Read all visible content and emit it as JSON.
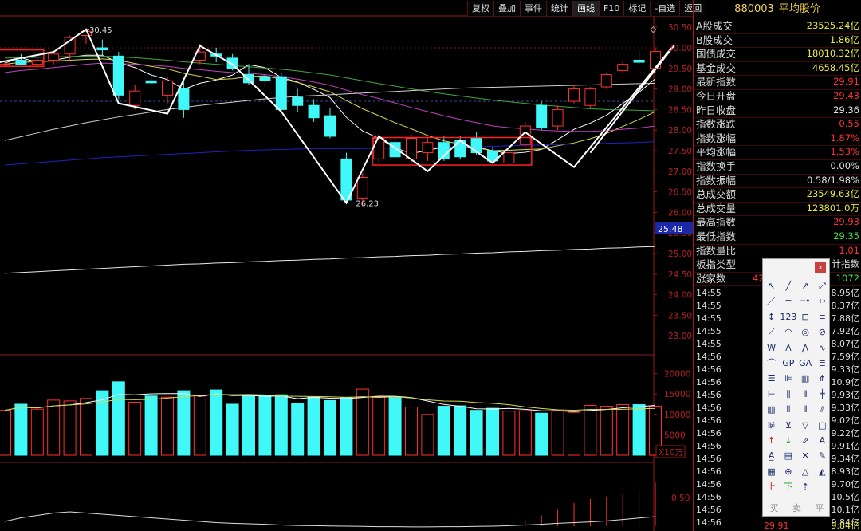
{
  "toolbar": {
    "items": [
      "复权",
      "叠加",
      "事件",
      "统计",
      "画线",
      "F10",
      "标记",
      "-自选",
      "返回"
    ],
    "active": "画线"
  },
  "colors": {
    "up": "#ff3030",
    "down": "#40f8f8",
    "ma5": "#ffffff",
    "ma10": "#d8d850",
    "ma20": "#c040c0",
    "ma30": "#40a840",
    "ma60": "#2020c0",
    "ma250": "#e8e8e8",
    "line": "#ffffff",
    "box": "#ff2020"
  },
  "price_axis": {
    "ticks": [
      "30.50",
      "30.00",
      "29.50",
      "29.00",
      "28.50",
      "28.00",
      "27.50",
      "27.00",
      "26.50",
      "26.00",
      "25.50",
      "25.00",
      "24.50",
      "24.00",
      "23.50",
      "23.00"
    ],
    "current": "25.48"
  },
  "vol_axis": {
    "ticks": [
      "20000",
      "15000",
      "10000",
      "5000"
    ],
    "unit": "X10万"
  },
  "ind_axis": {
    "ticks": [
      "0.50"
    ]
  },
  "annotations": {
    "high": "30.45",
    "low": "26.23"
  },
  "chart_data": {
    "type": "candlestick",
    "ylim": [
      22.7,
      30.75
    ],
    "candles": [
      [
        29.6,
        29.7,
        29.55,
        29.6
      ],
      [
        29.7,
        29.85,
        29.6,
        29.6
      ],
      [
        29.6,
        29.75,
        29.5,
        29.7
      ],
      [
        29.7,
        29.85,
        29.6,
        29.85
      ],
      [
        29.85,
        30.3,
        29.7,
        30.25
      ],
      [
        30.3,
        30.45,
        30.1,
        30.4
      ],
      [
        30.0,
        30.2,
        29.8,
        29.95
      ],
      [
        29.8,
        29.9,
        28.75,
        28.85
      ],
      [
        28.6,
        29.1,
        28.5,
        28.95
      ],
      [
        29.2,
        29.4,
        29.1,
        29.15
      ],
      [
        28.85,
        29.3,
        28.65,
        29.2
      ],
      [
        29.0,
        29.2,
        28.3,
        28.5
      ],
      [
        29.7,
        30.1,
        29.6,
        29.9
      ],
      [
        29.85,
        30.0,
        29.65,
        29.8
      ],
      [
        29.75,
        29.85,
        29.45,
        29.5
      ],
      [
        29.35,
        29.6,
        29.1,
        29.15
      ],
      [
        29.3,
        29.35,
        29.05,
        29.2
      ],
      [
        29.3,
        29.4,
        28.45,
        28.5
      ],
      [
        28.8,
        29.0,
        28.45,
        28.6
      ],
      [
        28.6,
        28.75,
        28.2,
        28.3
      ],
      [
        28.35,
        28.55,
        27.8,
        27.85
      ],
      [
        27.3,
        27.45,
        26.25,
        26.3
      ],
      [
        26.35,
        26.95,
        26.15,
        26.85
      ],
      [
        27.3,
        27.9,
        27.2,
        27.8
      ],
      [
        27.7,
        27.8,
        27.3,
        27.35
      ],
      [
        27.3,
        27.9,
        27.2,
        27.8
      ],
      [
        27.45,
        27.8,
        27.25,
        27.7
      ],
      [
        27.7,
        27.85,
        27.25,
        27.3
      ],
      [
        27.75,
        27.85,
        27.3,
        27.35
      ],
      [
        27.8,
        27.95,
        27.4,
        27.45
      ],
      [
        27.5,
        27.6,
        27.2,
        27.25
      ],
      [
        27.2,
        27.55,
        27.1,
        27.45
      ],
      [
        27.65,
        28.2,
        27.55,
        28.1
      ],
      [
        28.6,
        28.7,
        28.0,
        28.05
      ],
      [
        28.1,
        28.6,
        28.0,
        28.5
      ],
      [
        28.7,
        29.1,
        28.65,
        29.0
      ],
      [
        28.6,
        29.05,
        28.55,
        29.0
      ],
      [
        29.05,
        29.4,
        29.0,
        29.35
      ],
      [
        29.45,
        29.7,
        29.4,
        29.6
      ],
      [
        29.7,
        29.95,
        29.6,
        29.65
      ],
      [
        29.5,
        30.0,
        29.4,
        29.91
      ]
    ],
    "volumes": [
      11000,
      12500,
      11300,
      13500,
      13300,
      13900,
      15800,
      18000,
      13000,
      14500,
      14200,
      15800,
      14500,
      16000,
      12500,
      14500,
      14700,
      14800,
      12700,
      14200,
      13400,
      14200,
      16200,
      14300,
      14100,
      11800,
      10000,
      12000,
      12100,
      11000,
      11500,
      10800,
      10900,
      10300,
      11000,
      10500,
      12200,
      12000,
      12400,
      12400,
      12000
    ],
    "zigzag": [
      [
        -3,
        29.45
      ],
      [
        3,
        29.9
      ],
      [
        5,
        30.45
      ],
      [
        7,
        28.65
      ],
      [
        10,
        28.4
      ],
      [
        12,
        30.05
      ],
      [
        14,
        29.6
      ],
      [
        17,
        28.45
      ],
      [
        21,
        26.23
      ],
      [
        23,
        27.85
      ],
      [
        26,
        27.0
      ],
      [
        28,
        27.75
      ],
      [
        30,
        27.2
      ],
      [
        32,
        27.95
      ],
      [
        35,
        27.1
      ],
      [
        41,
        30.0
      ]
    ],
    "boxes": [
      [
        -1,
        2,
        29.55,
        29.95
      ],
      [
        23,
        32,
        27.15,
        27.82
      ]
    ],
    "ma": [
      {
        "name": "ma5",
        "values": [
          29.63,
          29.76,
          29.65,
          29.7,
          29.77,
          29.82,
          29.82,
          29.64,
          29.52,
          29.34,
          29.23,
          28.99,
          29.14,
          29.22,
          29.34,
          29.59,
          29.52,
          29.28,
          29.17,
          28.99,
          28.79,
          28.31,
          27.98,
          27.8,
          27.57,
          27.43,
          27.51,
          27.59,
          27.58,
          27.59,
          27.5,
          27.43,
          27.46,
          27.53,
          27.77,
          28.02,
          28.17,
          28.36,
          28.65,
          28.92,
          29.25
        ]
      },
      {
        "name": "ma10",
        "values": [
          29.6,
          29.65,
          29.66,
          29.68,
          29.7,
          29.72,
          29.73,
          29.7,
          29.62,
          29.55,
          29.49,
          29.38,
          29.31,
          29.23,
          29.25,
          29.3,
          29.32,
          29.24,
          29.16,
          29.05,
          28.93,
          28.72,
          28.52,
          28.35,
          28.18,
          28.03,
          27.87,
          27.74,
          27.66,
          27.57,
          27.5,
          27.51,
          27.53,
          27.54,
          27.62,
          27.69,
          27.79,
          27.92,
          28.09,
          28.26,
          28.45
        ]
      },
      {
        "name": "ma20",
        "values": [
          29.4,
          29.45,
          29.48,
          29.52,
          29.56,
          29.6,
          29.63,
          29.62,
          29.6,
          29.58,
          29.55,
          29.5,
          29.47,
          29.43,
          29.4,
          29.38,
          29.35,
          29.3,
          29.24,
          29.17,
          29.09,
          28.97,
          28.86,
          28.77,
          28.66,
          28.55,
          28.45,
          28.35,
          28.26,
          28.18,
          28.1,
          28.06,
          28.03,
          28.0,
          27.98,
          27.97,
          27.97,
          27.99,
          28.02,
          28.05,
          28.1
        ]
      },
      {
        "name": "ma30",
        "values": [
          29.75,
          29.76,
          29.77,
          29.78,
          29.79,
          29.8,
          29.8,
          29.78,
          29.76,
          29.73,
          29.7,
          29.66,
          29.63,
          29.6,
          29.57,
          29.54,
          29.51,
          29.48,
          29.44,
          29.39,
          29.34,
          29.27,
          29.2,
          29.13,
          29.07,
          29.0,
          28.94,
          28.88,
          28.83,
          28.78,
          28.73,
          28.69,
          28.65,
          28.61,
          28.58,
          28.55,
          28.52,
          28.5,
          28.49,
          28.48,
          28.47
        ]
      },
      {
        "name": "ma60",
        "values": [
          27.15,
          27.18,
          27.21,
          27.24,
          27.27,
          27.3,
          27.33,
          27.35,
          27.37,
          27.39,
          27.41,
          27.43,
          27.45,
          27.47,
          27.49,
          27.51,
          27.52,
          27.53,
          27.54,
          27.55,
          27.55,
          27.55,
          27.55,
          27.56,
          27.56,
          27.57,
          27.57,
          27.58,
          27.59,
          27.6,
          27.61,
          27.62,
          27.63,
          27.64,
          27.65,
          27.66,
          27.67,
          27.68,
          27.69,
          27.7,
          27.72
        ]
      },
      {
        "name": "ma250",
        "values": [
          24.52,
          24.54,
          24.56,
          24.58,
          24.6,
          24.62,
          24.64,
          24.66,
          24.68,
          24.7,
          24.72,
          24.74,
          24.75,
          24.77,
          24.78,
          24.8,
          24.81,
          24.83,
          24.84,
          24.86,
          24.87,
          24.89,
          24.9,
          24.92,
          24.93,
          24.95,
          24.96,
          24.98,
          24.99,
          25.01,
          25.02,
          25.04,
          25.05,
          25.07,
          25.08,
          25.1,
          25.11,
          25.13,
          25.14,
          25.16,
          25.17
        ]
      },
      {
        "name": "trend",
        "values": [
          27.75,
          27.84,
          27.93,
          28.02,
          28.1,
          28.18,
          28.25,
          28.32,
          28.38,
          28.44,
          28.5,
          28.55,
          28.6,
          28.64,
          28.68,
          28.72,
          28.76,
          28.79,
          28.82,
          28.84,
          28.86,
          28.88,
          28.9,
          28.92,
          28.94,
          28.96,
          28.98,
          29.0,
          29.02,
          29.03,
          29.04,
          29.05,
          29.06,
          29.07,
          29.08,
          29.09,
          29.1,
          29.11,
          29.12,
          29.13,
          29.14
        ]
      }
    ],
    "indicator": [
      0,
      0,
      0,
      0,
      0,
      0,
      0,
      0,
      0,
      0,
      0,
      0,
      0,
      0,
      0,
      0,
      0,
      0,
      0,
      0,
      0,
      0,
      0,
      0,
      0,
      0,
      0,
      0,
      0,
      0,
      0,
      0.05,
      0.12,
      0.22,
      0.33,
      0.47,
      0.55,
      0.6,
      0.65,
      0.72,
      0.9
    ]
  },
  "panel": {
    "code": "880003",
    "name": "平均股价",
    "rows": [
      {
        "label": "A股成交",
        "value": "23525.24亿",
        "color": "#e8e840"
      },
      {
        "label": "B股成交",
        "value": "1.86亿",
        "color": "#e8e840"
      },
      {
        "label": "国债成交",
        "value": "18010.32亿",
        "color": "#e8e840"
      },
      {
        "label": "基金成交",
        "value": "4658.45亿",
        "color": "#e8e840"
      },
      {
        "label": "最新指数",
        "value": "29.91",
        "color": "#ff3030"
      },
      {
        "label": "今日开盘",
        "value": "29.43",
        "color": "#ff3030"
      },
      {
        "label": "昨日收盘",
        "value": "29.36",
        "color": "#e0e0e0"
      },
      {
        "label": "指数涨跌",
        "value": "0.55",
        "color": "#ff3030"
      },
      {
        "label": "指数涨幅",
        "value": "1.87%",
        "color": "#ff3030"
      },
      {
        "label": "平均涨幅",
        "value": "1.53%",
        "color": "#ff3030"
      },
      {
        "label": "指数换手",
        "value": "0.00%",
        "color": "#e0e0e0"
      },
      {
        "label": "指数振幅",
        "value": "0.58/1.98%",
        "color": "#e0e0e0"
      },
      {
        "label": "总成交额",
        "value": "23549.63亿",
        "color": "#e8e840"
      },
      {
        "label": "总成交量",
        "value": "123801.0万",
        "color": "#e8e840"
      },
      {
        "label": "最高指数",
        "value": "29.93",
        "color": "#ff3030"
      },
      {
        "label": "最低指数",
        "value": "29.35",
        "color": "#40e040"
      },
      {
        "label": "指数量比",
        "value": "1.01",
        "color": "#ff3030"
      },
      {
        "label": "板指类型",
        "value": "计指数",
        "color": "#e0e0e0"
      },
      {
        "label": "涨家数",
        "value": "1072",
        "color": "#40e040",
        "mid": "42"
      }
    ],
    "ticks": [
      {
        "time": "14:55",
        "value": "8.95亿"
      },
      {
        "time": "14:55",
        "value": "8.37亿"
      },
      {
        "time": "14:55",
        "value": "7.88亿"
      },
      {
        "time": "14:55",
        "value": "7.92亿"
      },
      {
        "time": "14:55",
        "value": "8.07亿"
      },
      {
        "time": "14:56",
        "value": "7.59亿"
      },
      {
        "time": "14:56",
        "value": "9.33亿"
      },
      {
        "time": "14:56",
        "value": "10.9亿"
      },
      {
        "time": "14:56",
        "value": "9.93亿"
      },
      {
        "time": "14:56",
        "value": "9.33亿"
      },
      {
        "time": "14:56",
        "value": "9.02亿"
      },
      {
        "time": "14:56",
        "value": "9.22亿"
      },
      {
        "time": "14:56",
        "value": "9.91亿"
      },
      {
        "time": "14:56",
        "value": "9.34亿"
      },
      {
        "time": "14:56",
        "value": "8.93亿"
      },
      {
        "time": "14:56",
        "value": "9.70亿"
      },
      {
        "time": "14:56",
        "value": "10.5亿"
      },
      {
        "time": "14:56",
        "value": "10.1亿"
      },
      {
        "time": "14:56",
        "value": "9.84亿"
      }
    ],
    "last_tick": {
      "price": "29.91",
      "amount": "9.84亿"
    }
  },
  "palette": {
    "close": "x",
    "tools": [
      "↖",
      "╱",
      "↗",
      "⤢",
      "／",
      "━",
      "─•",
      "↔",
      "↕",
      "123",
      "⊟",
      "≡",
      "⟋",
      "◠",
      "◎",
      "⊘",
      "W",
      "𐌡",
      "⋀",
      "∿",
      "⌒",
      "GP",
      "GA",
      "≣",
      "☰",
      "⊫",
      "▥",
      "⋔",
      "⊢",
      "⫼",
      "⦀",
      "╪",
      "▥",
      "⦀",
      "⦀",
      "⫽",
      "⊯",
      "⊻",
      "▽",
      "□",
      "↑",
      "↓",
      "⇗",
      "A",
      "A̲",
      "▤",
      "✕",
      "✎",
      "▦",
      "⊕",
      "△",
      "◭",
      "上",
      "下",
      "⇡",
      "",
      "",
      ""
    ],
    "footer": [
      "买",
      "卖",
      "平"
    ]
  }
}
